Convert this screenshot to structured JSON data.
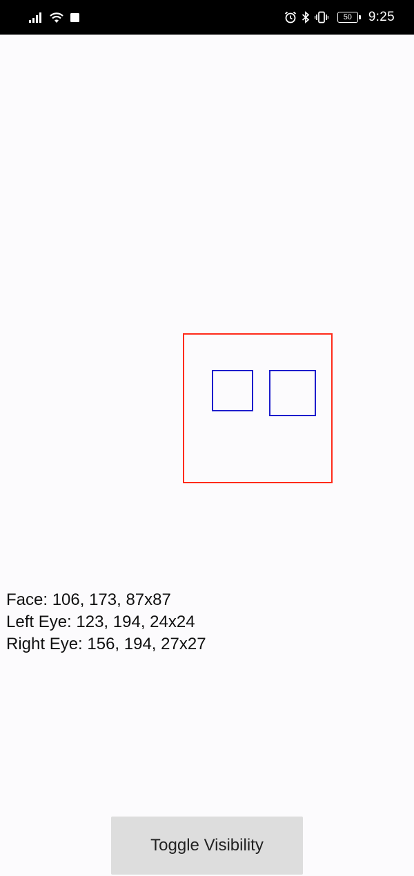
{
  "status_bar": {
    "time": "9:25",
    "battery_level": "50",
    "left_icons": [
      "signal-icon",
      "wifi-icon",
      "notification-square-icon"
    ],
    "right_icons": [
      "alarm-icon",
      "bluetooth-icon",
      "vibrate-icon",
      "battery-icon"
    ]
  },
  "detections": {
    "face_color": "#ff2b1a",
    "eye_color": "#1d1dcc"
  },
  "info": {
    "face": "Face: 106, 173, 87x87",
    "left_eye": "Left Eye: 123, 194, 24x24",
    "right_eye": "Right Eye: 156, 194, 27x27"
  },
  "actions": {
    "toggle_label": "Toggle Visibility"
  }
}
